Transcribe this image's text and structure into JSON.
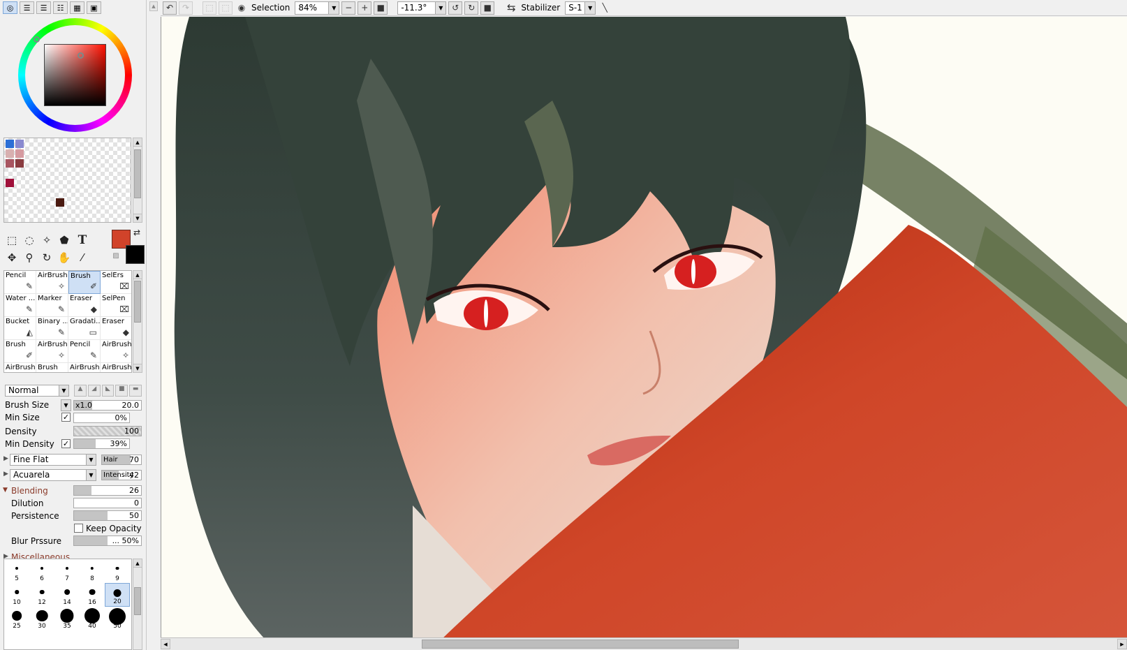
{
  "toolbar": {
    "selection_label": "Selection",
    "zoom_value": "84%",
    "rotation_value": "-11.3°",
    "stabilizer_label": "Stabilizer",
    "stabilizer_value": "S-1"
  },
  "colors": {
    "foreground": "#d1432a",
    "background": "#000000",
    "swatches": [
      "#2c6fd6",
      "#8a8ad0",
      "#d8b0b0",
      "#d59aa0",
      "#a85560",
      "#8a3c40",
      "#a0103a",
      "#4a1a10"
    ]
  },
  "brushes": [
    {
      "name": "Pencil",
      "icon": "pencil-icon"
    },
    {
      "name": "AirBrush",
      "icon": "airbrush-icon"
    },
    {
      "name": "Brush",
      "icon": "brush-icon"
    },
    {
      "name": "SelErs",
      "icon": "selection-eraser-icon"
    },
    {
      "name": "Water ...",
      "icon": "water-brush-icon"
    },
    {
      "name": "Marker",
      "icon": "marker-icon"
    },
    {
      "name": "Eraser",
      "icon": "eraser-icon"
    },
    {
      "name": "SelPen",
      "icon": "selection-pen-icon"
    },
    {
      "name": "Bucket",
      "icon": "bucket-icon"
    },
    {
      "name": "Binary ...",
      "icon": "binary-pen-icon"
    },
    {
      "name": "Gradati...",
      "icon": "gradation-icon"
    },
    {
      "name": "Eraser",
      "icon": "eraser-icon"
    },
    {
      "name": "Brush",
      "icon": "brush-icon"
    },
    {
      "name": "AirBrush",
      "icon": "airbrush-icon"
    },
    {
      "name": "Pencil",
      "icon": "pencil-icon"
    },
    {
      "name": "AirBrush",
      "icon": "airbrush-icon"
    },
    {
      "name": "AirBrush",
      "icon": "airbrush-icon"
    },
    {
      "name": "Brush",
      "icon": "brush-icon"
    },
    {
      "name": "AirBrush",
      "icon": "airbrush-icon"
    },
    {
      "name": "AirBrush",
      "icon": "airbrush-icon"
    }
  ],
  "props": {
    "blend_mode": "Normal",
    "brush_size_label": "Brush Size",
    "brush_size_mult": "x1.0",
    "brush_size_value": "20.0",
    "min_size_label": "Min Size",
    "min_size_value": "0%",
    "min_size_fraction": 0,
    "density_label": "Density",
    "density_value": "100",
    "min_density_label": "Min Density",
    "min_density_value": "39%",
    "min_density_fraction": 0.39,
    "texture_shape": "Fine Flat",
    "texture_shape_param": "Hair",
    "texture_shape_value": "70",
    "texture_paper": "Acuarela",
    "texture_paper_param": "Intensity",
    "texture_paper_value": "42",
    "blending_label": "Blending",
    "blending_value": "26",
    "blending_fraction": 0.26,
    "dilution_label": "Dilution",
    "dilution_value": "0",
    "persistence_label": "Persistence",
    "persistence_value": "50",
    "persistence_fraction": 0.5,
    "keep_opacity_label": "Keep Opacity",
    "blur_pressure_label": "Blur Prssure",
    "blur_pressure_value": "... 50%",
    "blur_pressure_fraction": 0.5,
    "misc_label": "Miscellaneous"
  },
  "dot_sizes": [
    "5",
    "6",
    "7",
    "8",
    "9",
    "10",
    "12",
    "14",
    "16",
    "20",
    "25",
    "30",
    "35",
    "40",
    "50"
  ],
  "selected_dot_size": "20"
}
